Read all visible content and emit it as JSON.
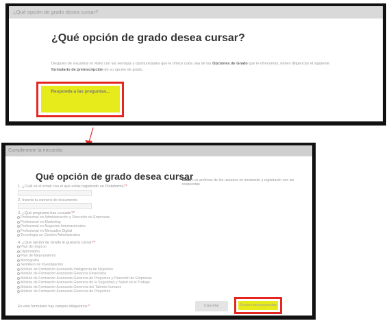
{
  "top": {
    "titlebar": "¿Qué opción de grado desea cursar?",
    "heading": "¿Qué opción de grado desea cursar?",
    "desc_1": "Después de visualizar el video con las ventajas y oportunidades que le ofrece cada una de las ",
    "desc_bold_1": "Opciones de Grado",
    "desc_2": " que le ofrecemos, debes diligenciar el siguiente ",
    "desc_bold_2": "formulario de preinscripción",
    "desc_3": " de su opción de grado.",
    "button_label": "Responda a las preguntas...",
    "button_color": "#e7ea1b"
  },
  "bottom": {
    "titlebar": "Cumplimente la encuesta",
    "heading": "Qué opción de grado desea cursar",
    "note_bold": "Nota:",
    "note": " Los archivos de los usuarios se mostrarán y registrarán con las respuestas",
    "q1_label": "1. ¿Cuál es el email con el que estás registrado en Plataforma?",
    "q2_label": "2. Inserta tu número de documento",
    "q3_label": "3. ¿Qué programa has cursado?",
    "q3_options": [
      "Profesional en Administración y Dirección de Empresas",
      "Profesional en Marketing",
      "Profesional en Negocios Internacionales",
      "Profesional en Mercadeo Digital",
      "Tecnología en Gestión Administrativa"
    ],
    "q4_label": "4. ¿Qué opción de Grado le gustaría cursar?",
    "q4_options": [
      "Plan de negocio",
      "Diplomados",
      "Plan de Mejoramiento",
      "Monografía",
      "Semillero de Investigación",
      "Módulo de Formación Avanzada Inteligencia de Negocios",
      "Módulo de Formación Avanzada Gerencia Financiera",
      "Módulo de Formación Avanzada Gerencia de Proyectos y Dirección de Empresas",
      "Módulo de Formación Avanzada Gerencia de la Seguridad y Salud en el Trabajo",
      "Módulo de Formación Avanzada Gerencia del Talento Humano",
      "Módulo de Formación Avanzada Gerencia de Proyectos"
    ],
    "required_mark": "*",
    "footnote": "En este formulario hay campos obligatorios ",
    "cancel_label": "Cancelar",
    "submit_label": "Enviar mis respuestas",
    "highlight_color": "#e52620"
  }
}
